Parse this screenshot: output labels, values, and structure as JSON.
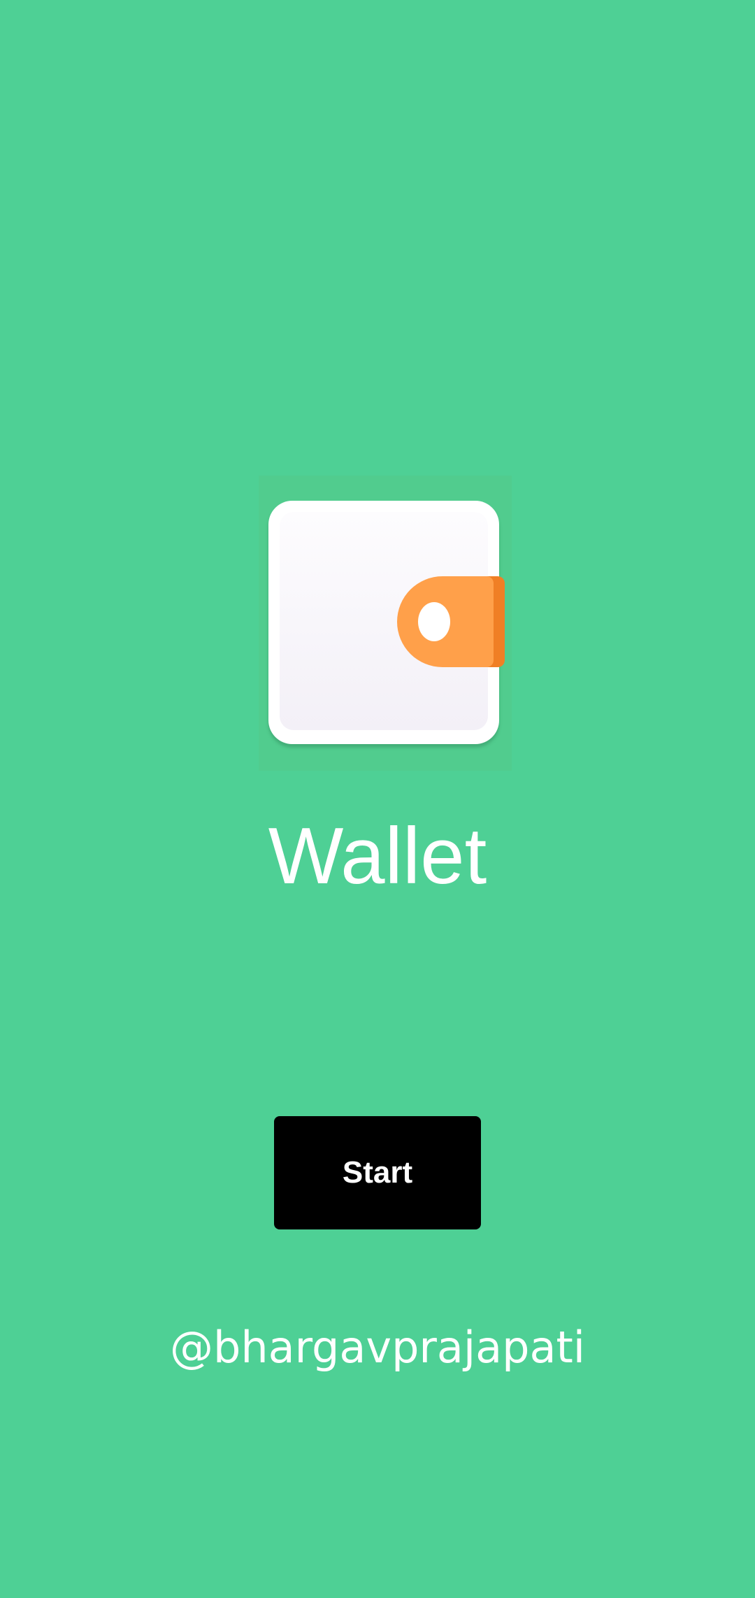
{
  "app": {
    "title": "Wallet",
    "logo_icon": "wallet-icon"
  },
  "actions": {
    "start_label": "Start"
  },
  "footer": {
    "credit": "@bhargavprajapati"
  },
  "colors": {
    "background": "#4ed095",
    "button": "#000000",
    "button_text": "#ffffff",
    "wallet_body": "#ffffff",
    "wallet_tab": "#ffa04a",
    "wallet_tab_edge": "#f07f25"
  }
}
